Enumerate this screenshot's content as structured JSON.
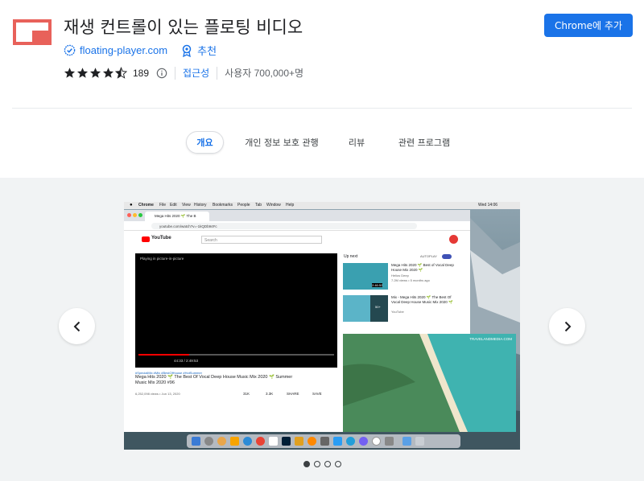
{
  "header": {
    "title": "재생 컨트롤이 있는 플로팅 비디오",
    "publisher": "floating-player.com",
    "badge": "추천",
    "rating_value": 4.5,
    "rating_count": "189",
    "accessibility": "접근성",
    "users": "사용자 700,000+명",
    "add_button": "Chrome에 추가",
    "logo_color": "#e8615a",
    "accent": "#1a73e8"
  },
  "tabs": [
    {
      "label": "개요",
      "active": true
    },
    {
      "label": "개인 정보 보호 관행",
      "active": false
    },
    {
      "label": "리뷰",
      "active": false
    },
    {
      "label": "관련 프로그램",
      "active": false
    }
  ],
  "gallery": {
    "prev_icon": "chevron-left-icon",
    "next_icon": "chevron-right-icon",
    "slide_count": 4,
    "active_slide": 1,
    "screenshot": {
      "menubar": {
        "app": "Chrome",
        "menus": [
          "File",
          "Edit",
          "View",
          "History",
          "Bookmarks",
          "People",
          "Tab",
          "Window",
          "Help"
        ],
        "clock": "Wed 14:06"
      },
      "tab_title": "Mega Hits 2020 🌱 The B",
      "url": "youtube.com/watch?v=-1kQDb94Fc",
      "search_placeholder": "Search",
      "pip_label": "Playing in picture-in-picture",
      "time": "44:33 / 2:49:53",
      "hashtags": "#SpecialMix #Mix #BestOfHouse #HotSummer",
      "video_title": "Mega Hits 2020 🌱 The Best Of Vocal Deep House Music Mix 2020 🌱 Summer Music Mix 2020 #96",
      "video_meta": "6,252,098 views • Jun 13, 2020",
      "likes": "31K",
      "dislikes": "3.3K",
      "share": "SHARE",
      "save": "SAVE",
      "up_next": "Up next",
      "autoplay": "AUTOPLAY",
      "rec1_title": "Mega Hits 2020 🌱 Best of Vocal Deep House Mix 2020 🌱",
      "rec1_channel": "Helios Deep",
      "rec1_meta": "7.2M views • 5 months ago",
      "rec1_duration": "2:46:52",
      "rec2_title": "Mix - Mega Hits 2020 🌱 The Best Of Vocal Deep House Music Mix 2020 🌱",
      "rec2_channel": "YouTube",
      "rec2_badge": "50+",
      "watermark": "TRAVELANDMEDIA.COM"
    }
  }
}
